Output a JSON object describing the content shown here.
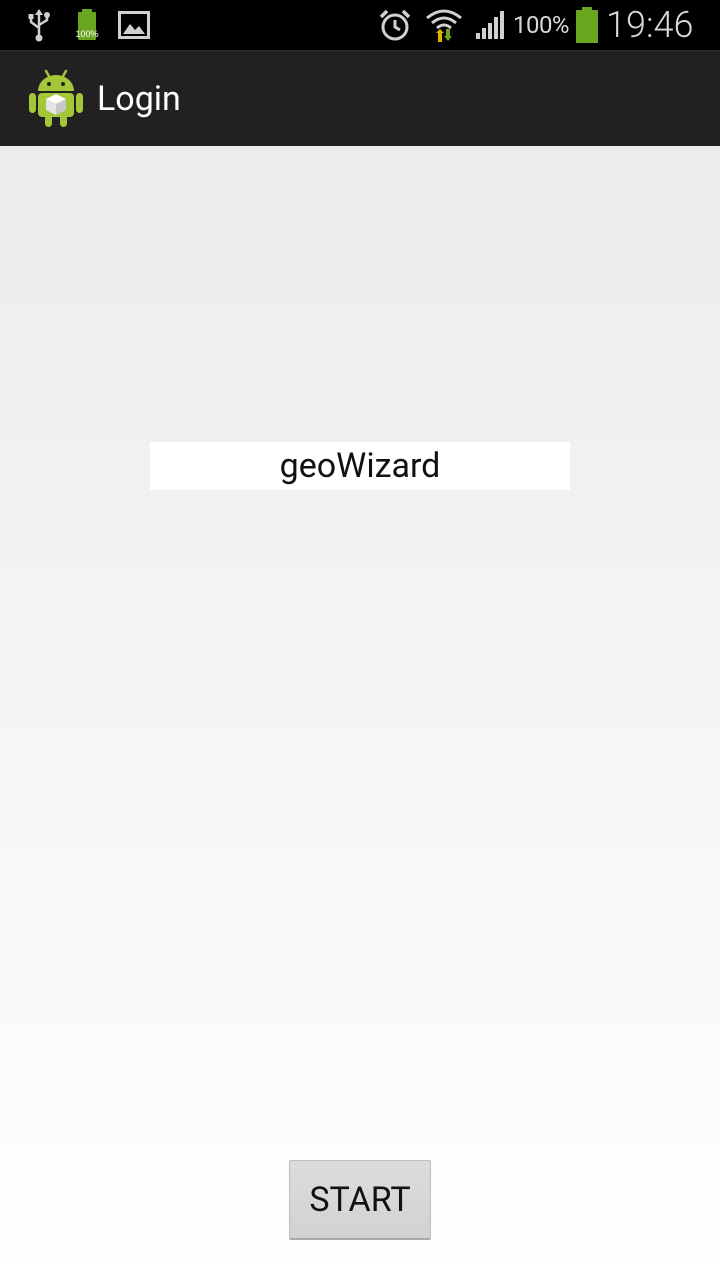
{
  "status_bar": {
    "notification_battery_percent": "100%",
    "battery_percent": "100%",
    "time": "19:46",
    "icons": [
      "usb-icon",
      "battery-notification-icon",
      "gallery-icon",
      "alarm-icon",
      "wifi-icon",
      "signal-icon",
      "battery-icon"
    ]
  },
  "action_bar": {
    "title": "Login",
    "icon": "android-app-icon"
  },
  "main": {
    "brand_text": "geoWizard",
    "start_button_label": "START"
  },
  "colors": {
    "action_bar_bg": "#212121",
    "status_bar_bg": "#000000",
    "battery_green": "#6aa51f",
    "android_green": "#a4c639"
  }
}
